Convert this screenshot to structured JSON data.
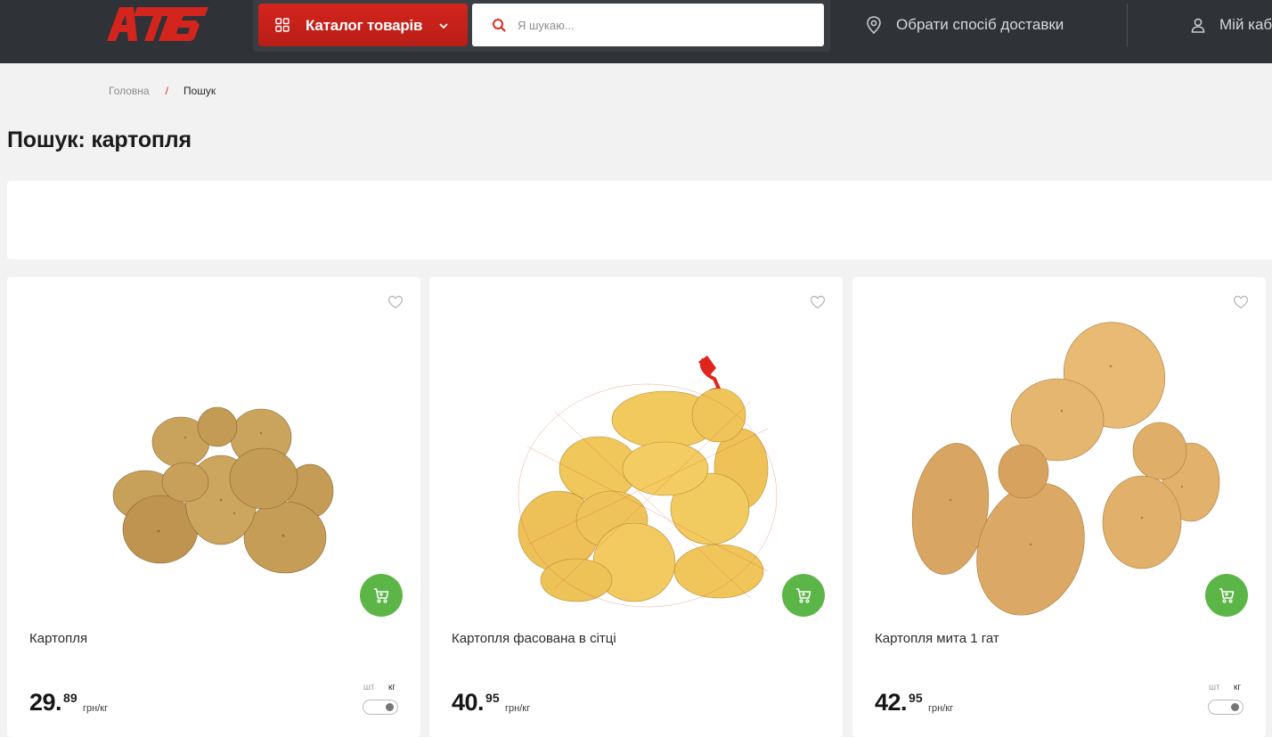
{
  "header": {
    "logo_text": "АТБ",
    "catalog_label": "Каталог товарів",
    "search_placeholder": "Я шукаю...",
    "delivery_label": "Обрати спосіб доставки",
    "account_label": "Мій каб"
  },
  "breadcrumb": {
    "home": "Головна",
    "separator": "/",
    "current": "Пошук"
  },
  "page_title": "Пошук: картопля",
  "colors": {
    "brand_red": "#d3251d",
    "header_bg": "#2f3237",
    "cart_green": "#5cb547"
  },
  "products": [
    {
      "name": "Картопля",
      "price_main": "29.",
      "price_kop": "89",
      "unit": "грн/кг",
      "unit_toggle": {
        "left": "шт",
        "right": "кг"
      },
      "image": "potatoes-pile"
    },
    {
      "name": "Картопля фасована в сітці",
      "price_main": "40.",
      "price_kop": "95",
      "unit": "грн/кг",
      "unit_toggle": null,
      "image": "potatoes-in-net"
    },
    {
      "name": "Картопля мита 1 гат",
      "price_main": "42.",
      "price_kop": "95",
      "unit": "грн/кг",
      "unit_toggle": {
        "left": "шт",
        "right": "кг"
      },
      "image": "washed-potatoes"
    }
  ]
}
